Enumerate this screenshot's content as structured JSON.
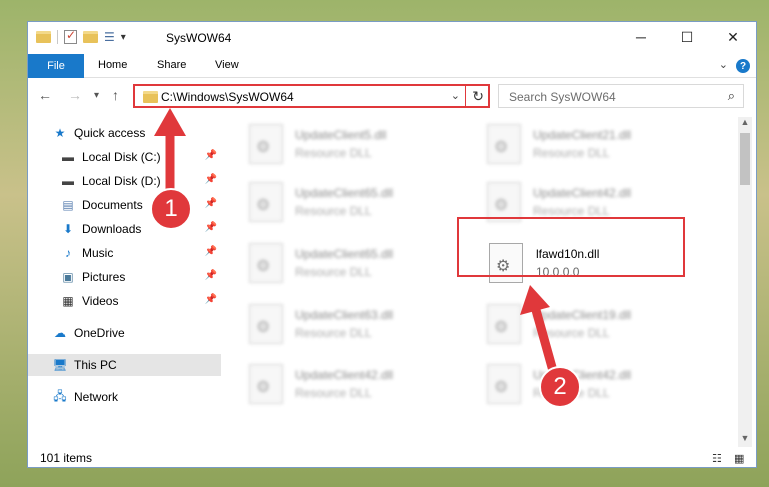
{
  "window": {
    "title": "SysWOW64"
  },
  "ribbon": {
    "file": "File",
    "tabs": [
      "Home",
      "Share",
      "View"
    ]
  },
  "address": {
    "path": "C:\\Windows\\SysWOW64"
  },
  "search": {
    "placeholder": "Search SysWOW64"
  },
  "sidebar": {
    "items": [
      {
        "label": "Quick access",
        "icon": "star-icon",
        "pinned": false
      },
      {
        "label": "Local Disk (C:)",
        "icon": "drive-icon",
        "pinned": true
      },
      {
        "label": "Local Disk (D:)",
        "icon": "drive-icon",
        "pinned": true
      },
      {
        "label": "Documents",
        "icon": "document-icon",
        "pinned": true
      },
      {
        "label": "Downloads",
        "icon": "download-icon",
        "pinned": true
      },
      {
        "label": "Music",
        "icon": "music-icon",
        "pinned": true
      },
      {
        "label": "Pictures",
        "icon": "pictures-icon",
        "pinned": true
      },
      {
        "label": "Videos",
        "icon": "video-icon",
        "pinned": true
      },
      {
        "label": "OneDrive",
        "icon": "cloud-icon",
        "pinned": false
      },
      {
        "label": "This PC",
        "icon": "computer-icon",
        "pinned": false,
        "selected": true
      },
      {
        "label": "Network",
        "icon": "network-icon",
        "pinned": false
      }
    ]
  },
  "files": [
    {
      "name": "UpdateClient5.dll",
      "desc": "Resource DLL"
    },
    {
      "name": "UpdateClient21.dll",
      "desc": "Resource DLL"
    },
    {
      "name": "UpdateClient65.dll",
      "desc": "Resource DLL"
    },
    {
      "name": "UpdateClient42.dll",
      "desc": "Resource DLL"
    },
    {
      "name": "UpdateClient65.dll",
      "desc": "Resource DLL"
    },
    {
      "name": "lfawd10n.dll",
      "desc": "10.0.0.0",
      "highlight": true
    },
    {
      "name": "UpdateClient63.dll",
      "desc": "Resource DLL"
    },
    {
      "name": "UpdateClient19.dll",
      "desc": "Resource DLL"
    },
    {
      "name": "UpdateClient42.dll",
      "desc": "Resource DLL"
    },
    {
      "name": "UpdateClient42.dll",
      "desc": "Resource DLL"
    }
  ],
  "status": {
    "count": "101 items"
  },
  "annotations": {
    "step1": "1",
    "step2": "2"
  },
  "colors": {
    "accent": "#1979ca",
    "highlight": "#e0383b"
  }
}
